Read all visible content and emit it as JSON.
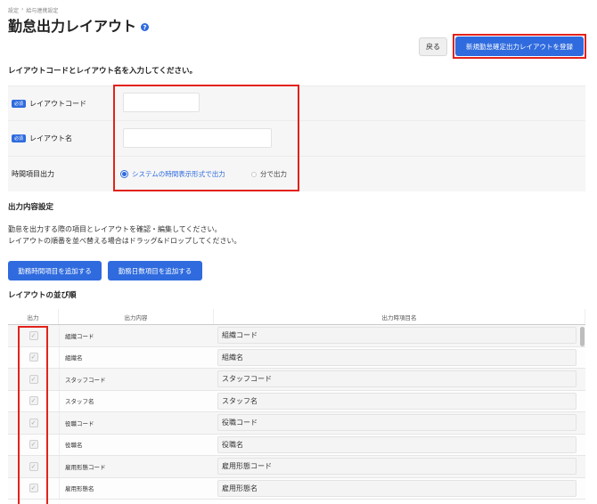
{
  "breadcrumb": [
    "設定",
    "›",
    "給与連携設定"
  ],
  "page_title": "勤怠出力レイアウト",
  "buttons": {
    "back": "戻る",
    "register": "新規勤怠確定出力レイアウトを登録",
    "add_time_item": "勤務時間項目を追加する",
    "add_days_item": "勤務日数項目を追加する"
  },
  "form_heading": "レイアウトコードとレイアウト名を入力してください。",
  "required_badge": "必須",
  "form": {
    "code_label": "レイアウトコード",
    "code_value": "",
    "name_label": "レイアウト名",
    "name_value": "",
    "time_output_label": "時間項目出力",
    "time_option_system": "システムの時間表示形式で出力",
    "time_option_minutes": "分で出力",
    "time_selected": "system"
  },
  "output_heading": "出力内容設定",
  "description": [
    "勤怠を出力する際の項目とレイアウトを確認・編集してください。",
    "レイアウトの順番を並べ替える場合はドラッグ&ドロップしてください。"
  ],
  "order_heading": "レイアウトの並び順",
  "table": {
    "headers": [
      "出力",
      "出力内容",
      "出力時項目名"
    ],
    "rows": [
      {
        "content": "組織コード",
        "name": "組織コード",
        "checked": true
      },
      {
        "content": "組織名",
        "name": "組織名",
        "checked": true
      },
      {
        "content": "スタッフコード",
        "name": "スタッフコード",
        "checked": true
      },
      {
        "content": "スタッフ名",
        "name": "スタッフ名",
        "checked": true
      },
      {
        "content": "役職コード",
        "name": "役職コード",
        "checked": true
      },
      {
        "content": "役職名",
        "name": "役職名",
        "checked": true
      },
      {
        "content": "雇用形態コード",
        "name": "雇用形態コード",
        "checked": true
      },
      {
        "content": "雇用形態名",
        "name": "雇用形態名",
        "checked": true
      }
    ]
  },
  "colors": {
    "accent": "#2f6bde",
    "highlight": "#e3221c"
  },
  "icons": {
    "help": "question-circle-icon",
    "checkbox": "checkmark-icon"
  }
}
